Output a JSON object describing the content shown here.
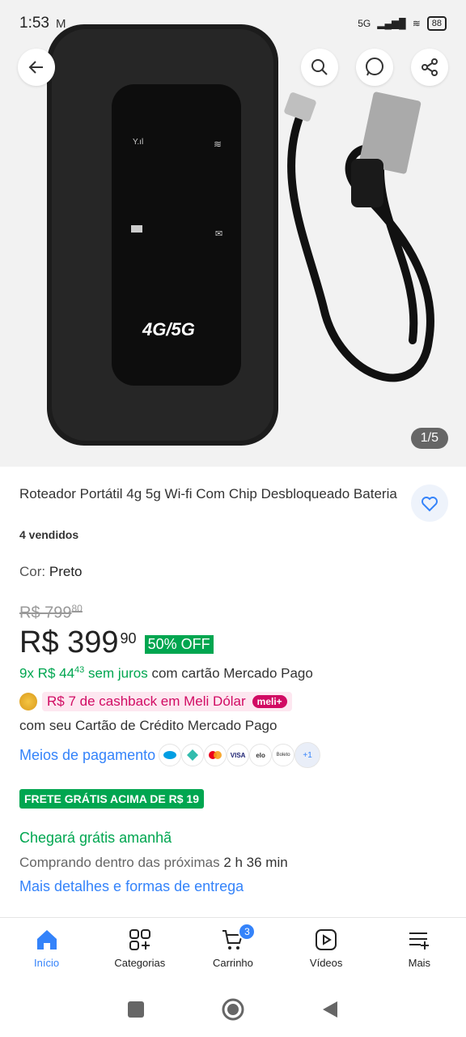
{
  "status": {
    "time": "1:53",
    "network": "5G",
    "battery": "88"
  },
  "gallery": {
    "counter": "1/5"
  },
  "product": {
    "title": "Roteador Portátil 4g 5g Wi-fi Com Chip Desbloqueado Bateria",
    "sold": "4 vendidos",
    "color_label": "Cor:",
    "color_value": "Preto",
    "old_price_main": "R$ 799",
    "old_price_cents": "80",
    "price_main": "R$ 399",
    "price_cents": "90",
    "discount": "50% OFF",
    "installments_green_a": "9x R$ 44",
    "installments_cents": "43",
    "installments_green_b": "sem juros",
    "installments_rest": "com cartão Mercado Pago",
    "cashback": "R$ 7 de cashback em Meli Dólar",
    "cashback_badge": "meli+",
    "card_text": "com seu Cartão de Crédito Mercado Pago",
    "payment_link": "Meios de pagamento",
    "payment_more": "+1",
    "pay_visa": "VISA",
    "pay_elo": "elo",
    "pay_boleto": "Boleto",
    "frete": "FRETE GRÁTIS ACIMA DE R$ 19",
    "arrival": "Chegará grátis amanhã",
    "arrival_sub_a": "Comprando dentro das próximas",
    "arrival_sub_b": "2 h 36 min",
    "delivery_link": "Mais detalhes e formas de entrega"
  },
  "device_label": "4G/5G",
  "nav": [
    {
      "label": "Início"
    },
    {
      "label": "Categorias"
    },
    {
      "label": "Carrinho",
      "badge": "3"
    },
    {
      "label": "Vídeos"
    },
    {
      "label": "Mais"
    }
  ],
  "colors": {
    "accent": "#3483fa",
    "green": "#00a650",
    "pink": "#d10b63"
  }
}
